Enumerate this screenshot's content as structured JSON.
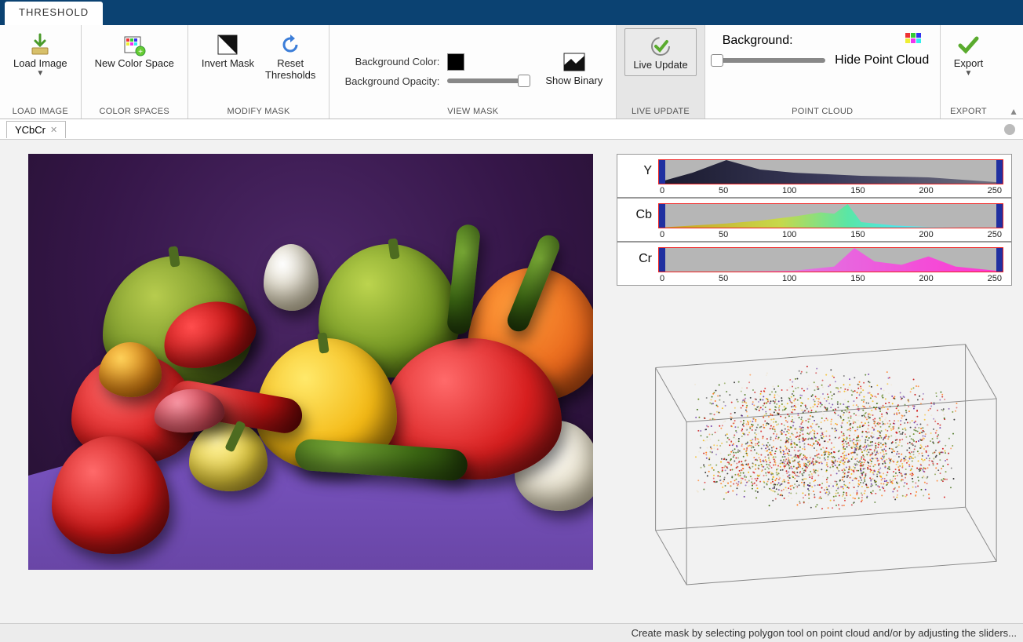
{
  "title_tab": "THRESHOLD",
  "toolstrip": {
    "load_image": {
      "label": "Load Image",
      "group": "LOAD IMAGE"
    },
    "color_spaces": {
      "new_cs": "New Color Space",
      "group": "COLOR SPACES"
    },
    "modify_mask": {
      "invert": "Invert Mask",
      "reset": "Reset\nThresholds",
      "group": "MODIFY MASK"
    },
    "view_mask": {
      "bg_color": "Background Color:",
      "bg_opacity": "Background Opacity:",
      "show_binary": "Show Binary",
      "group": "VIEW MASK",
      "color": "#000000"
    },
    "live_update": {
      "label": "Live Update",
      "group": "LIVE UPDATE"
    },
    "point_cloud": {
      "bg_label": "Background:",
      "hide": "Hide Point Cloud",
      "group": "POINT CLOUD"
    },
    "export": {
      "label": "Export",
      "group": "EXPORT"
    }
  },
  "doc_tab": "YCbCr",
  "histograms": [
    {
      "label": "Y",
      "ticks": [
        "0",
        "50",
        "100",
        "150",
        "200",
        "250"
      ]
    },
    {
      "label": "Cb",
      "ticks": [
        "0",
        "50",
        "100",
        "150",
        "200",
        "250"
      ]
    },
    {
      "label": "Cr",
      "ticks": [
        "0",
        "50",
        "100",
        "150",
        "200",
        "250"
      ]
    }
  ],
  "status": "Create mask by selecting polygon tool on point cloud and/or by adjusting the sliders...",
  "chart_data": [
    {
      "type": "area",
      "title": "Y channel histogram",
      "xlabel": "",
      "ylabel": "",
      "x": [
        0,
        25,
        50,
        75,
        100,
        125,
        150,
        175,
        200,
        225,
        250
      ],
      "values": [
        2,
        14,
        30,
        18,
        14,
        12,
        10,
        9,
        8,
        5,
        2
      ],
      "xlim": [
        0,
        255
      ],
      "ylim": [
        0,
        1
      ],
      "slider": {
        "low": 0,
        "high": 255
      }
    },
    {
      "type": "area",
      "title": "Cb channel histogram",
      "xlabel": "",
      "ylabel": "",
      "x": [
        0,
        25,
        50,
        75,
        100,
        120,
        130,
        140,
        150,
        175,
        200,
        225,
        250
      ],
      "values": [
        0,
        3,
        6,
        10,
        16,
        22,
        20,
        34,
        8,
        3,
        1,
        0,
        0
      ],
      "xlim": [
        0,
        255
      ],
      "ylim": [
        0,
        1
      ],
      "slider": {
        "low": 0,
        "high": 255
      }
    },
    {
      "type": "area",
      "title": "Cr channel histogram",
      "xlabel": "",
      "ylabel": "",
      "x": [
        0,
        50,
        100,
        130,
        145,
        160,
        180,
        200,
        220,
        250
      ],
      "values": [
        0,
        0,
        1,
        6,
        28,
        12,
        8,
        18,
        6,
        1
      ],
      "xlim": [
        0,
        255
      ],
      "ylim": [
        0,
        1
      ],
      "slider": {
        "low": 0,
        "high": 255
      }
    }
  ]
}
